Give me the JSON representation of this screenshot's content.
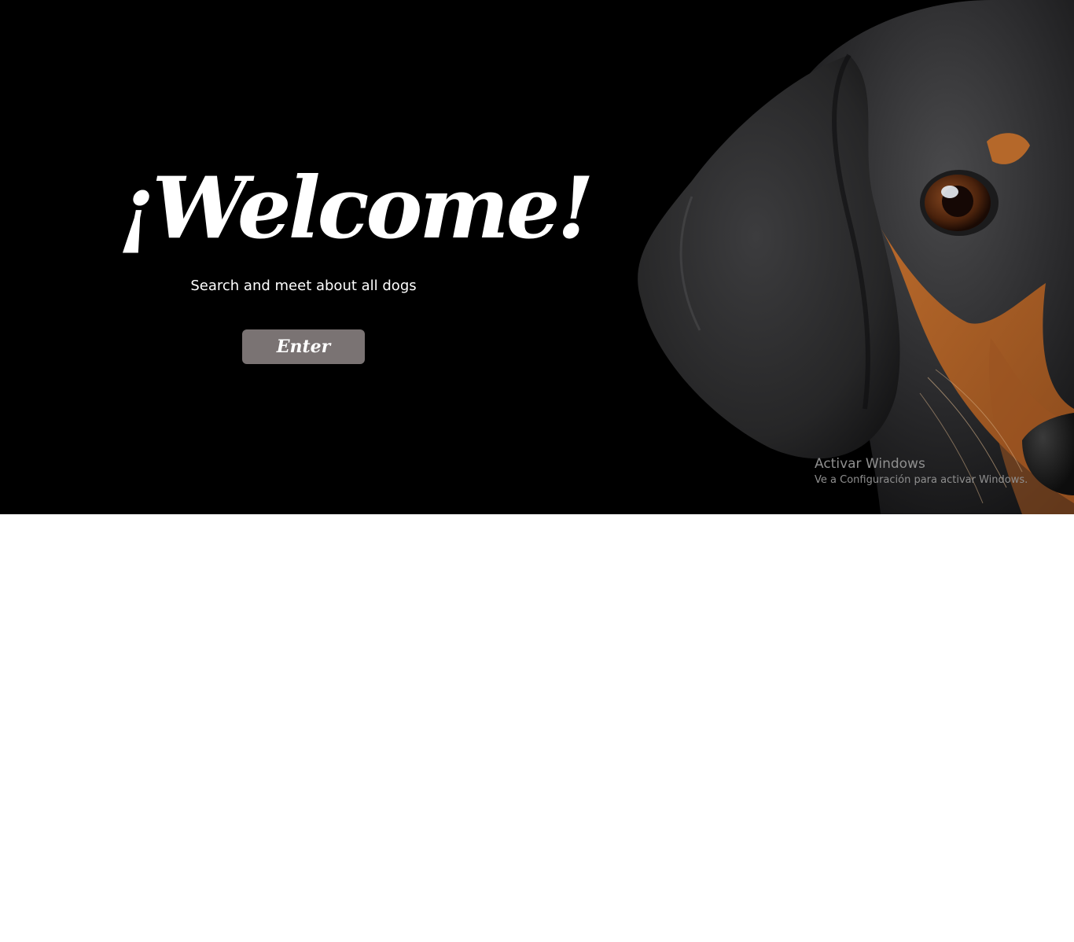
{
  "landing": {
    "title": "¡Welcome!",
    "subtitle": "Search and meet about all dogs",
    "enter_label": "Enter"
  },
  "photo": {
    "icon": "dachshund-dog-photo"
  },
  "windows_activation": {
    "title": "Activar Windows",
    "subtitle": "Ve a Configuración para activar Windows."
  },
  "colors": {
    "background": "#000000",
    "button": "#7a7373",
    "text": "#ffffff",
    "watermark": "#8f8f8f"
  }
}
